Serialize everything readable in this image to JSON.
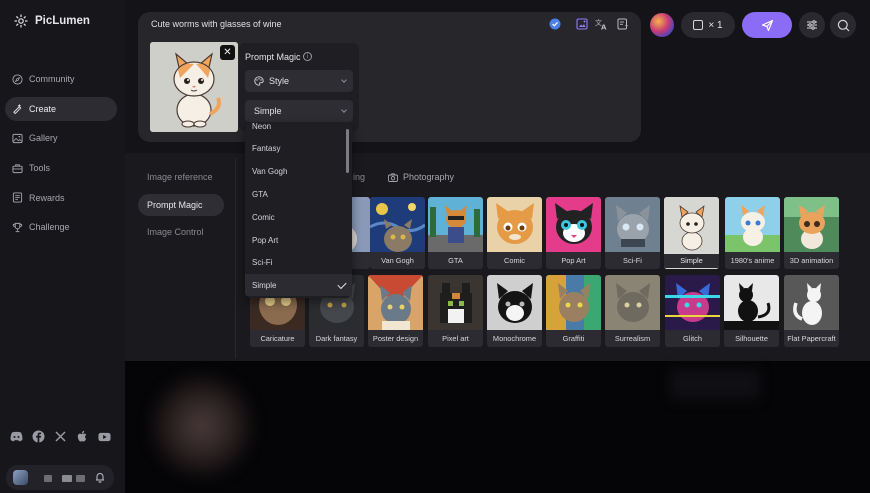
{
  "app": {
    "name": "PicLumen"
  },
  "sidebar": {
    "items": [
      {
        "label": "Community",
        "icon": "compass-icon",
        "active": false
      },
      {
        "label": "Create",
        "icon": "create-icon",
        "active": true
      },
      {
        "label": "Gallery",
        "icon": "gallery-icon",
        "active": false
      },
      {
        "label": "Tools",
        "icon": "tools-icon",
        "active": false
      },
      {
        "label": "Rewards",
        "icon": "rewards-icon",
        "active": false
      },
      {
        "label": "Challenge",
        "icon": "trophy-icon",
        "active": false
      }
    ],
    "social": [
      "discord-icon",
      "facebook-icon",
      "x-icon",
      "apple-icon",
      "youtube-icon"
    ]
  },
  "prompt": {
    "text": "Cute worms with glasses of wine"
  },
  "toolbar": {
    "count_label": "× 1"
  },
  "prompt_magic": {
    "title": "Prompt Magic",
    "style_label": "Style",
    "selected_value": "Simple"
  },
  "dropdown": {
    "options": [
      "Neon",
      "Fantasy",
      "Van Gogh",
      "GTA",
      "Comic",
      "Pop Art",
      "Sci-Fi",
      "Simple"
    ],
    "selected": "Simple"
  },
  "left_menu": {
    "items": [
      {
        "label": "Image reference",
        "active": false
      },
      {
        "label": "Prompt Magic",
        "active": true
      },
      {
        "label": "Image Control",
        "active": false
      }
    ]
  },
  "tabs": {
    "partial_label": "ing",
    "photography_label": "Photography"
  },
  "styles": {
    "row1": [
      "",
      "Van Gogh",
      "GTA",
      "Comic",
      "Pop Art",
      "Sci-Fi",
      "Simple",
      "1980's anime",
      "3D animation"
    ],
    "row2": [
      "Caricature",
      "Dark fantasy",
      "Poster design",
      "Pixel art",
      "Monochrome",
      "Graffiti",
      "Surrealism",
      "Glitch",
      "Silhouette",
      "Flat Papercraft"
    ]
  },
  "colors": {
    "accent": "#8a6cf6",
    "background": "#141418",
    "panel": "#26262b"
  }
}
